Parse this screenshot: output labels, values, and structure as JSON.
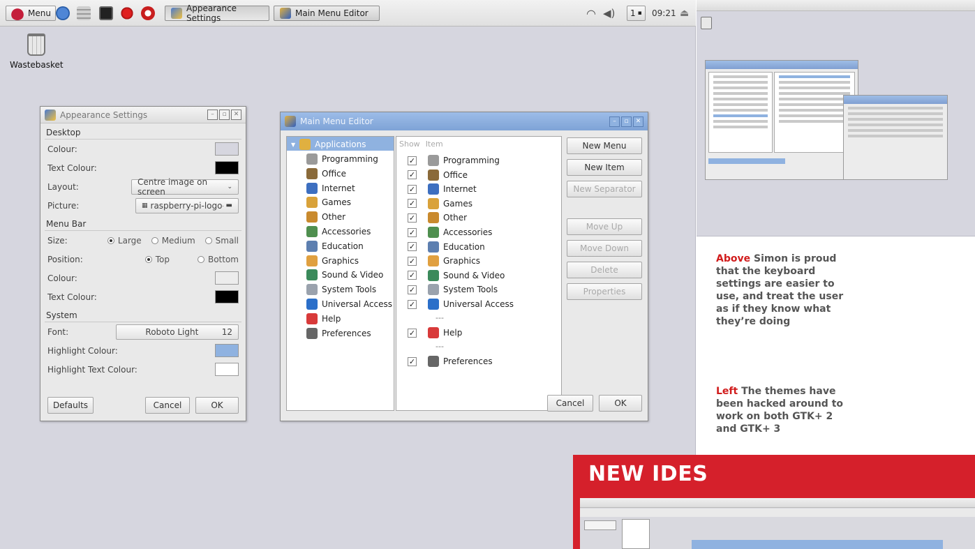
{
  "taskbar": {
    "menu_label": "Menu",
    "tasks": [
      "Appearance Settings",
      "Main Menu Editor"
    ],
    "workspace": "1",
    "clock": "09:21"
  },
  "desktop": {
    "wastebasket_label": "Wastebasket"
  },
  "appearance": {
    "title": "Appearance Settings",
    "desktop_section": "Desktop",
    "colour_label": "Colour:",
    "text_colour_label": "Text Colour:",
    "layout_label": "Layout:",
    "layout_value": "Centre image on screen",
    "picture_label": "Picture:",
    "picture_value": "raspberry-pi-logo-...",
    "menubar_section": "Menu Bar",
    "size_label": "Size:",
    "size_large": "Large",
    "size_medium": "Medium",
    "size_small": "Small",
    "position_label": "Position:",
    "position_top": "Top",
    "position_bottom": "Bottom",
    "mb_colour_label": "Colour:",
    "mb_text_colour_label": "Text Colour:",
    "system_section": "System",
    "font_label": "Font:",
    "font_name": "Roboto Light",
    "font_size": "12",
    "highlight_colour_label": "Highlight Colour:",
    "highlight_text_colour_label": "Highlight Text Colour:",
    "defaults_button": "Defaults",
    "cancel_button": "Cancel",
    "ok_button": "OK",
    "colors": {
      "desktop_colour": "#d6d6df",
      "desktop_text": "#000000",
      "menubar_colour": "#e8e8e8",
      "menubar_text": "#000000",
      "highlight": "#8fb2e0",
      "highlight_text": "#ffffff"
    }
  },
  "menu_editor": {
    "title": "Main Menu Editor",
    "root": "Applications",
    "categories": [
      "Programming",
      "Office",
      "Internet",
      "Games",
      "Other",
      "Accessories",
      "Education",
      "Graphics",
      "Sound & Video",
      "System Tools",
      "Universal Access",
      "Help",
      "Preferences"
    ],
    "col_show": "Show",
    "col_item": "Item",
    "items": [
      {
        "label": "Programming",
        "sep": false
      },
      {
        "label": "Office",
        "sep": false
      },
      {
        "label": "Internet",
        "sep": false
      },
      {
        "label": "Games",
        "sep": false
      },
      {
        "label": "Other",
        "sep": false
      },
      {
        "label": "Accessories",
        "sep": false
      },
      {
        "label": "Education",
        "sep": false
      },
      {
        "label": "Graphics",
        "sep": false
      },
      {
        "label": "Sound & Video",
        "sep": false
      },
      {
        "label": "System Tools",
        "sep": false
      },
      {
        "label": "Universal Access",
        "sep": false
      },
      {
        "label": "---",
        "sep": true
      },
      {
        "label": "Help",
        "sep": false
      },
      {
        "label": "---",
        "sep": true
      },
      {
        "label": "Preferences",
        "sep": false
      }
    ],
    "buttons": {
      "new_menu": "New Menu",
      "new_item": "New Item",
      "new_separator": "New Separator",
      "move_up": "Move Up",
      "move_down": "Move Down",
      "delete": "Delete",
      "properties": "Properties",
      "cancel": "Cancel",
      "ok": "OK"
    },
    "icon_colors": [
      "#9a9a9a",
      "#8a6a3a",
      "#3d6fc0",
      "#d9a23a",
      "#c98a2e",
      "#4f8f4f",
      "#5d7fb0",
      "#e0a040",
      "#3b8a5b",
      "#9aa2ad",
      "#2b6fc9",
      "#d83a3a",
      "#666666"
    ]
  },
  "captions": {
    "above_lead": "Above",
    "above_text": "Simon is proud that the keyboard settings are easier to use, and treat the user as if they know what they’re doing",
    "left_lead": "Left",
    "left_text": "The themes have been hacked around to work on both GTK+ 2 and GTK+ 3",
    "new_ides": "NEW IDES"
  }
}
